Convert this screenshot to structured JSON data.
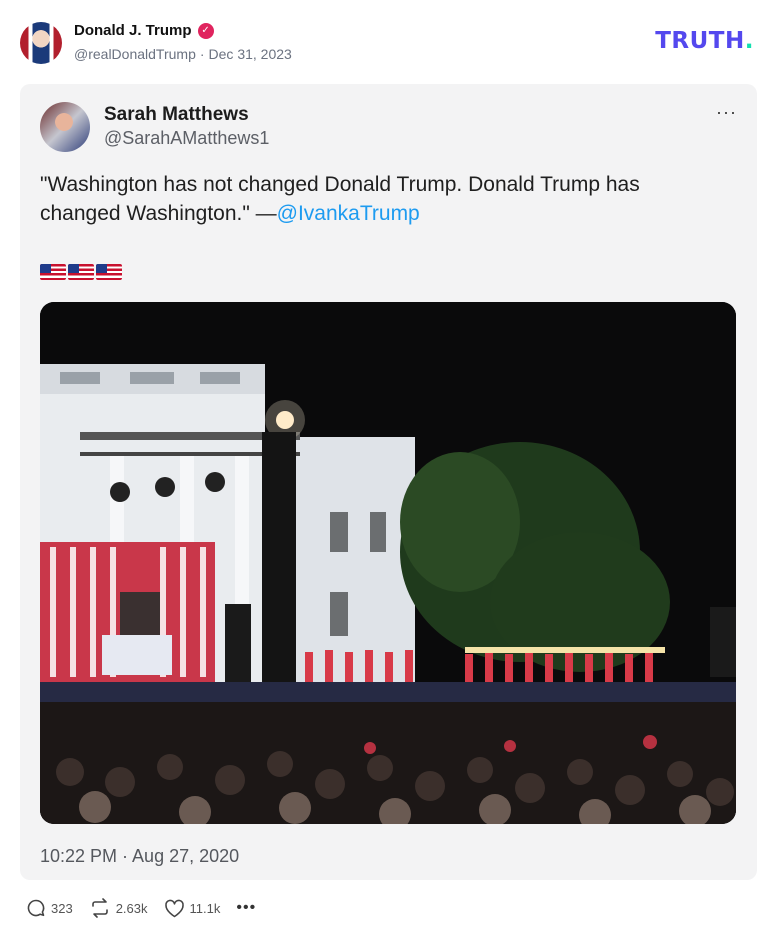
{
  "post": {
    "author_name": "Donald J. Trump",
    "handle": "@realDonaldTrump",
    "separator": "·",
    "date": "Dec 31, 2023",
    "verified_icon": "verified-badge-icon",
    "brand": {
      "logo_text": "TRUTH",
      "logo_dot": ".",
      "color": "#5448ee",
      "dot_color": "#12e0b0"
    }
  },
  "quoted": {
    "name": "Sarah Matthews",
    "handle": "@SarahAMatthews1",
    "text": "\"Washington has not changed Donald Trump. Donald Trump has changed Washington.\" —",
    "mention": "@IvankaTrump",
    "emoji": "🇺🇸🇺🇸🇺🇸",
    "timestamp": "10:22 PM · Aug 27, 2020",
    "more": "···"
  },
  "stats": {
    "replies": "323",
    "retruths": "2.63k",
    "likes": "11.1k",
    "more": "•••"
  },
  "colors": {
    "mention": "#1d9bf0",
    "verified": "#e0245e",
    "card_bg": "#f3f3f4"
  }
}
